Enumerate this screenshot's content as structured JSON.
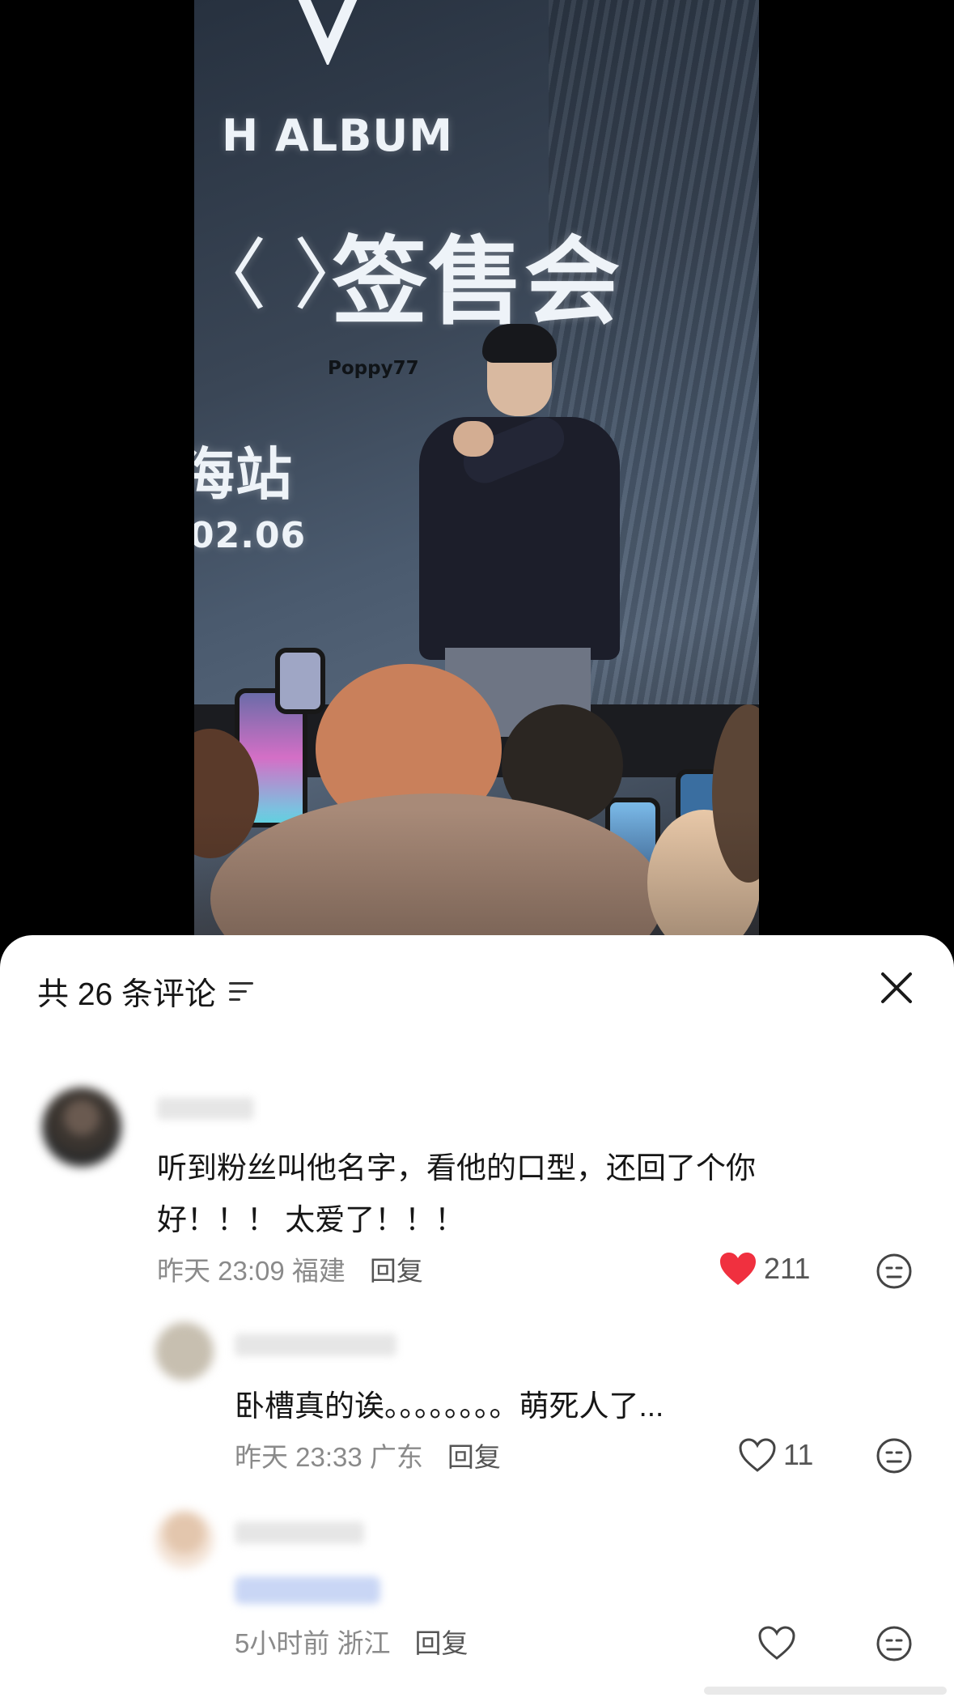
{
  "video": {
    "banner_album": "H ALBUM",
    "banner_chevron": "〈 〉",
    "banner_event": "签售会",
    "banner_station": "海站",
    "banner_date": "02.06",
    "watermark": "Poppy77"
  },
  "sheet": {
    "title": "共 26 条评论",
    "sort_icon": "sort-lines-icon",
    "close_icon": "close-icon"
  },
  "comments": [
    {
      "text": "听到粉丝叫他名字，看他的口型，还回了个你好！！！ 太爱了！！！",
      "meta": "昨天 23:09 福建",
      "reply": "回复",
      "likes": "211",
      "liked": true,
      "like_color": "#f0303f"
    },
    {
      "text": "卧槽真的诶。。。。。。。。萌死人了...",
      "meta": "昨天 23:33 广东",
      "reply": "回复",
      "likes": "11",
      "liked": false
    },
    {
      "text": "",
      "meta": "5小时前 浙江",
      "reply": "回复",
      "likes": "",
      "liked": false
    }
  ]
}
